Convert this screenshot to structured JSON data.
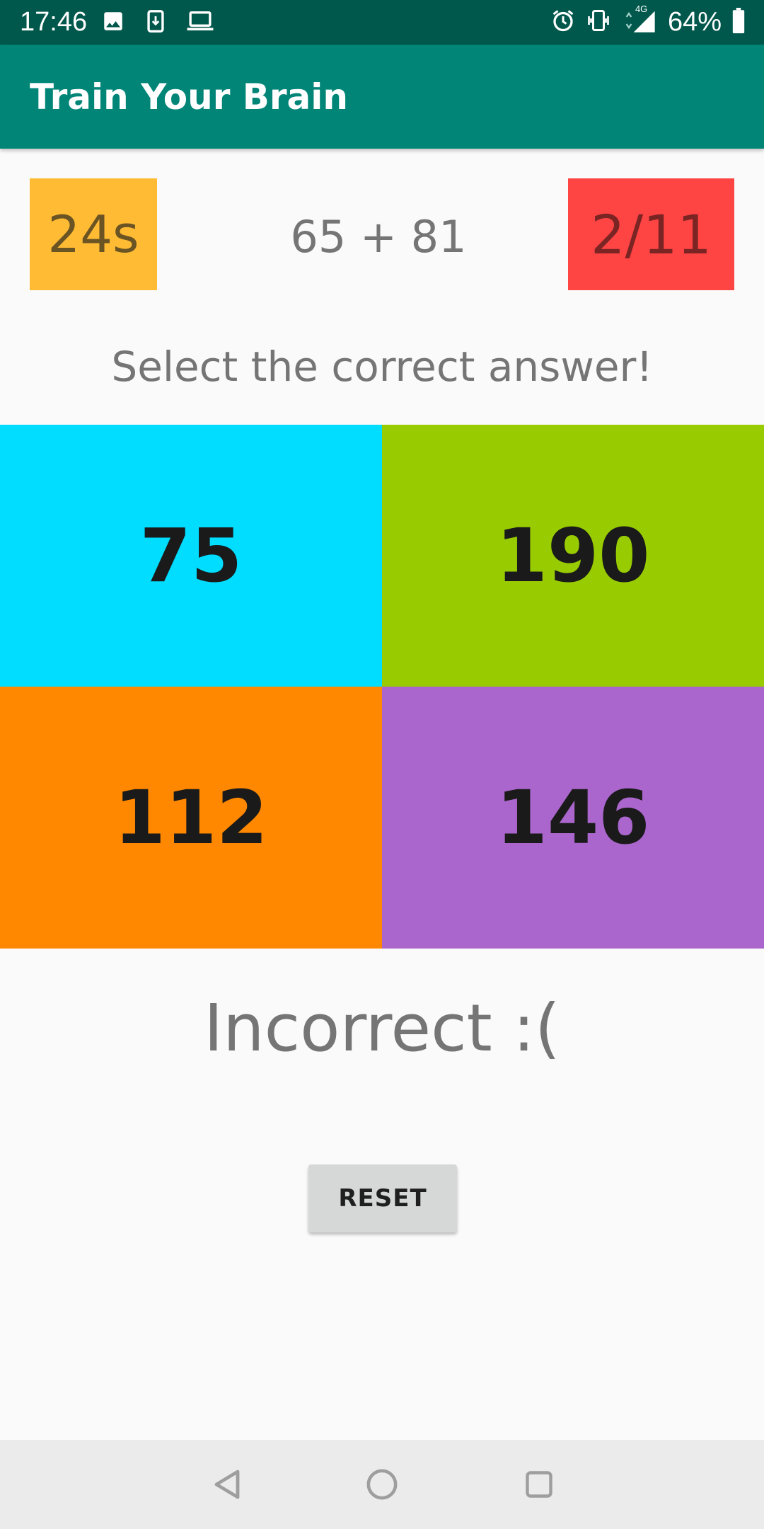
{
  "status_bar": {
    "time": "17:46",
    "battery": "64%",
    "network": "4G",
    "icons_left": [
      "image-icon",
      "download-icon",
      "laptop-icon"
    ],
    "icons_right": [
      "alarm-icon",
      "vibrate-icon",
      "signal-icon",
      "battery-icon"
    ]
  },
  "app_bar": {
    "title": "Train Your Brain"
  },
  "game": {
    "timer": "24s",
    "question": "65 + 81",
    "score": "2/11",
    "instruction": "Select the correct answer!",
    "answers": [
      {
        "value": "75",
        "color": "#00DDFF"
      },
      {
        "value": "190",
        "color": "#99CC00"
      },
      {
        "value": "112",
        "color": "#FF8800"
      },
      {
        "value": "146",
        "color": "#AA66CC"
      }
    ],
    "result": "Incorrect :(",
    "reset_label": "RESET"
  },
  "colors": {
    "status_bar": "#00574B",
    "app_bar": "#008577",
    "timer_bg": "#FFBB33",
    "score_bg": "#FF4444",
    "nav_bar": "#EBEBEB"
  },
  "nav_bar": {
    "buttons": [
      "back-icon",
      "home-icon",
      "recents-icon"
    ]
  }
}
